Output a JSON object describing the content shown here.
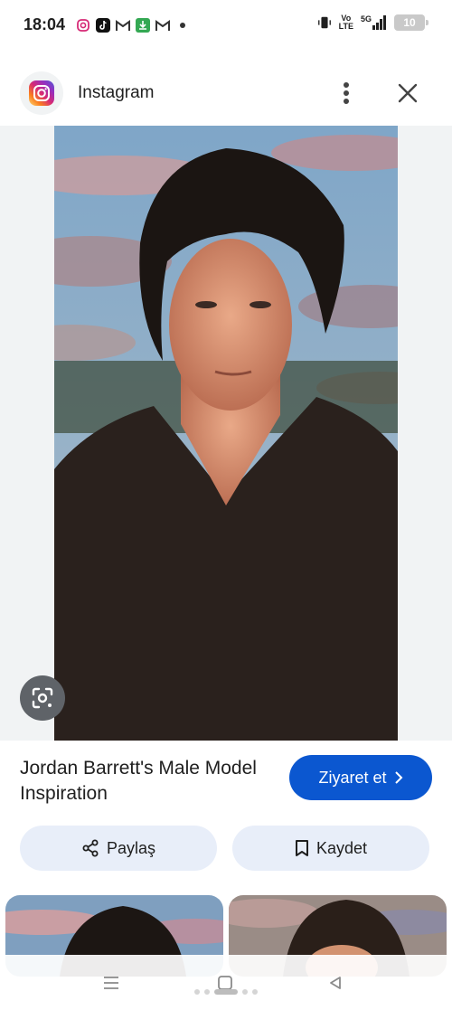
{
  "status_bar": {
    "time": "18:04",
    "network_top": "Vo",
    "network_bottom": "LTE",
    "signal_label": "5G",
    "battery": "10"
  },
  "header": {
    "source_name": "Instagram"
  },
  "result": {
    "title": "Jordan Barrett's Male Model Inspiration",
    "visit_label": "Ziyaret et"
  },
  "actions": {
    "share_label": "Paylaş",
    "save_label": "Kaydet"
  },
  "colors": {
    "accent": "#0b57d0",
    "action_bg": "#e8eef9"
  }
}
